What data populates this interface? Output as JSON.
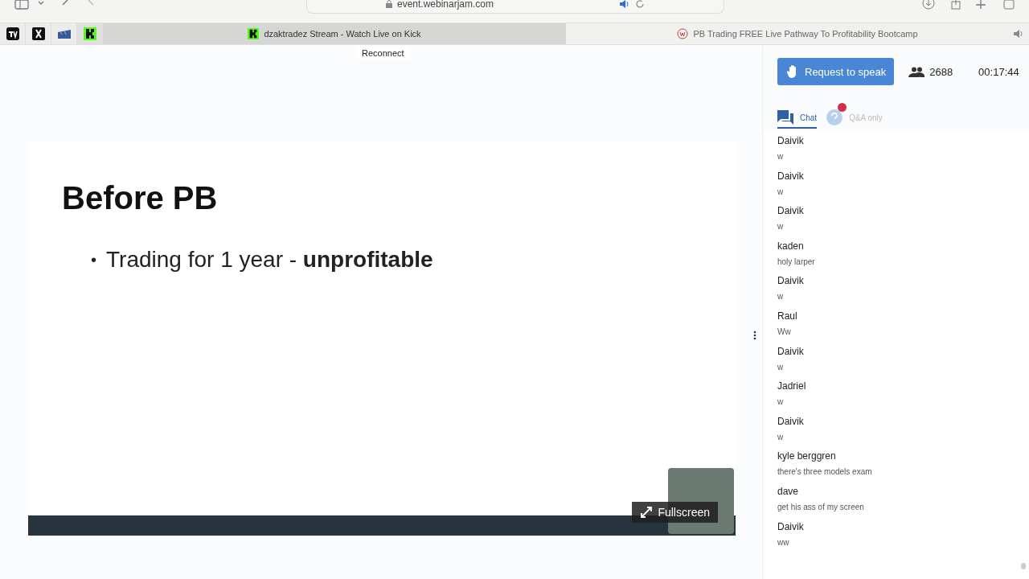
{
  "browser": {
    "address": "event.webinarjam.com",
    "pinned_tabs": [
      {
        "kind": "tv",
        "selected": false
      },
      {
        "kind": "x",
        "selected": false
      },
      {
        "kind": "clapper",
        "selected": false
      },
      {
        "kind": "k",
        "selected": true
      }
    ],
    "tabs": [
      {
        "title": "dzaktradez Stream - Watch Live on Kick",
        "kind": "k",
        "selected": true
      },
      {
        "title": "PB Trading FREE Live Pathway To Profitability Bootcamp",
        "kind": "wj",
        "selected": false
      }
    ]
  },
  "tooltip": "Reconnect",
  "slide": {
    "title": "Before PB",
    "bullets": [
      {
        "marker": "•",
        "text": "Trading for 1 year - **unprofitable**"
      }
    ]
  },
  "video": {
    "fullscreen_label": "Fullscreen"
  },
  "panel": {
    "request_button": "Request to speak",
    "attendees": "2688",
    "timer": "00:17:44",
    "tabs": [
      {
        "label": "Chat",
        "selected": true,
        "alert": false
      },
      {
        "label": "Q&A only",
        "selected": false,
        "alert": true
      }
    ],
    "messages": [
      {
        "name": "Daivik",
        "text": "w"
      },
      {
        "name": "Daivik",
        "text": "w"
      },
      {
        "name": "Daivik",
        "text": "w"
      },
      {
        "name": "kaden",
        "text": "holy larper"
      },
      {
        "name": "Daivik",
        "text": "w"
      },
      {
        "name": "Raul",
        "text": "Ww"
      },
      {
        "name": "Daivik",
        "text": "w"
      },
      {
        "name": "Jadriel",
        "text": "w"
      },
      {
        "name": "Daivik",
        "text": "w"
      },
      {
        "name": "kyle berggren",
        "text": "there's three models exam"
      },
      {
        "name": "dave",
        "text": "get his ass of my screen"
      },
      {
        "name": "Daivik",
        "text": "ww"
      }
    ]
  }
}
